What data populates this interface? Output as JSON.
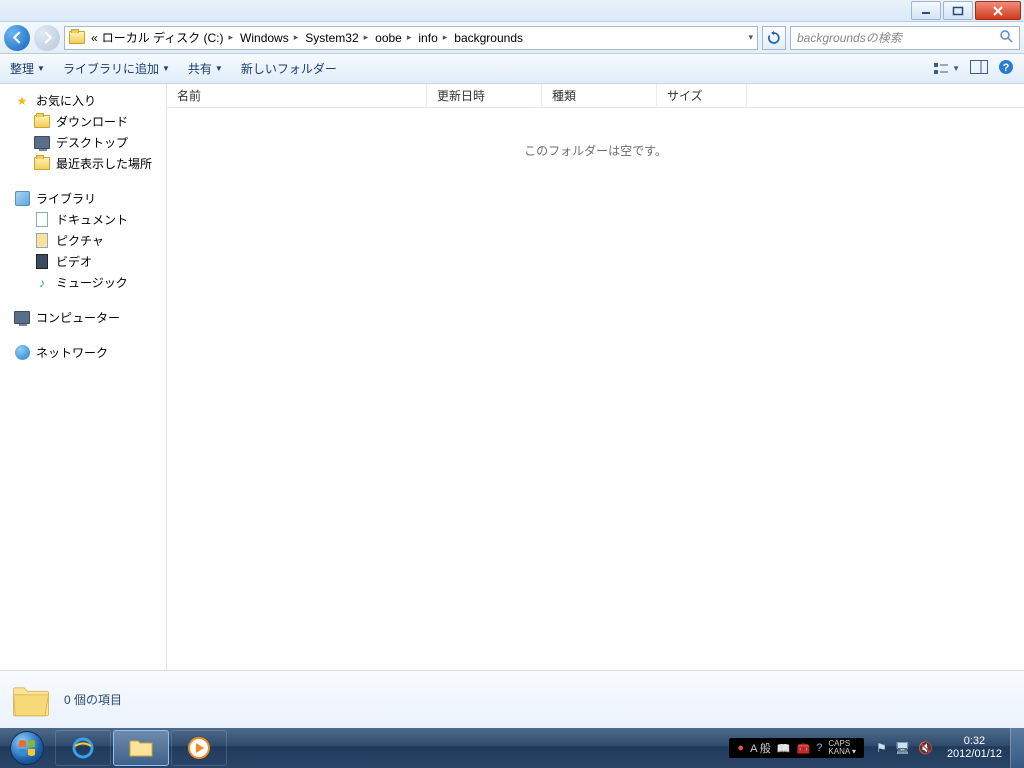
{
  "breadcrumb": {
    "prefix": "«",
    "items": [
      "ローカル ディスク (C:)",
      "Windows",
      "System32",
      "oobe",
      "info",
      "backgrounds"
    ]
  },
  "search": {
    "placeholder": "backgroundsの検索"
  },
  "toolbar": {
    "organize": "整理",
    "addToLibrary": "ライブラリに追加",
    "share": "共有",
    "newFolder": "新しいフォルダー"
  },
  "columns": {
    "name": "名前",
    "modified": "更新日時",
    "type": "種類",
    "size": "サイズ"
  },
  "emptyMessage": "このフォルダーは空です。",
  "nav": {
    "favorites": "お気に入り",
    "downloads": "ダウンロード",
    "desktop": "デスクトップ",
    "recent": "最近表示した場所",
    "libraries": "ライブラリ",
    "documents": "ドキュメント",
    "pictures": "ピクチャ",
    "videos": "ビデオ",
    "music": "ミュージック",
    "computer": "コンピューター",
    "network": "ネットワーク"
  },
  "details": {
    "count": "0 個の項目"
  },
  "ime": {
    "mode": "A 般",
    "caps": "CAPS",
    "kana": "KANA"
  },
  "clock": {
    "time": "0:32",
    "date": "2012/01/12"
  }
}
